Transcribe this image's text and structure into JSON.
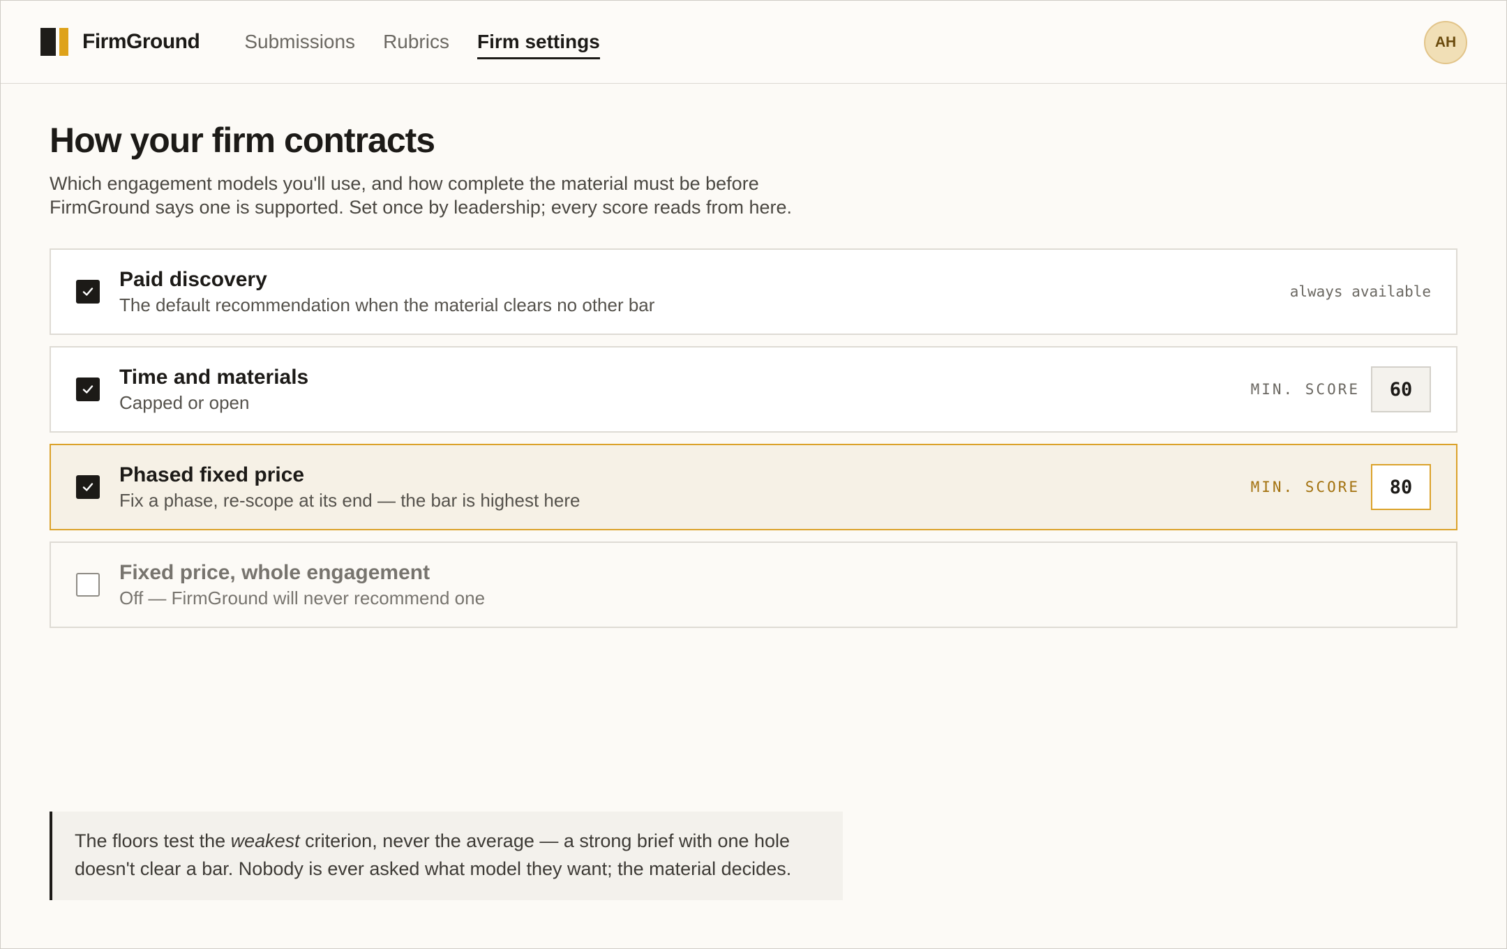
{
  "app": {
    "name": "FirmGround"
  },
  "nav": {
    "items": [
      {
        "label": "Submissions",
        "active": false
      },
      {
        "label": "Rubrics",
        "active": false
      },
      {
        "label": "Firm settings",
        "active": true
      }
    ]
  },
  "user": {
    "initials": "AH"
  },
  "page": {
    "title": "How your firm contracts",
    "subtitle": "Which engagement models you'll use, and how complete the material must be before FirmGround says one is supported. Set once by leadership; every score reads from here."
  },
  "models": [
    {
      "title": "Paid discovery",
      "description": "The default recommendation when the material clears no other bar",
      "checked": true,
      "right_text": "always available"
    },
    {
      "title": "Time and materials",
      "description": "Capped or open",
      "checked": true,
      "min_label": "MIN. SCORE",
      "min_score": "60"
    },
    {
      "title": "Phased fixed price",
      "description": "Fix a phase, re-scope at its end — the bar is highest here",
      "checked": true,
      "min_label": "MIN. SCORE",
      "min_score": "80"
    },
    {
      "title": "Fixed price, whole engagement",
      "description": "Off — FirmGround will never recommend one",
      "checked": false
    }
  ],
  "note": {
    "before": "The floors test the ",
    "emphasis": "weakest",
    "after": " criterion, never the average — a strong brief with one hole doesn't clear a bar. Nobody is ever asked what model they want; the material decides."
  },
  "colors": {
    "accent": "#dba22a",
    "ink": "#1c1a17",
    "background": "#fcfaf6",
    "highlight_bg": "#f6f1e6"
  },
  "icons": {
    "check": "check-icon",
    "logo": "logo-mark-icon"
  }
}
